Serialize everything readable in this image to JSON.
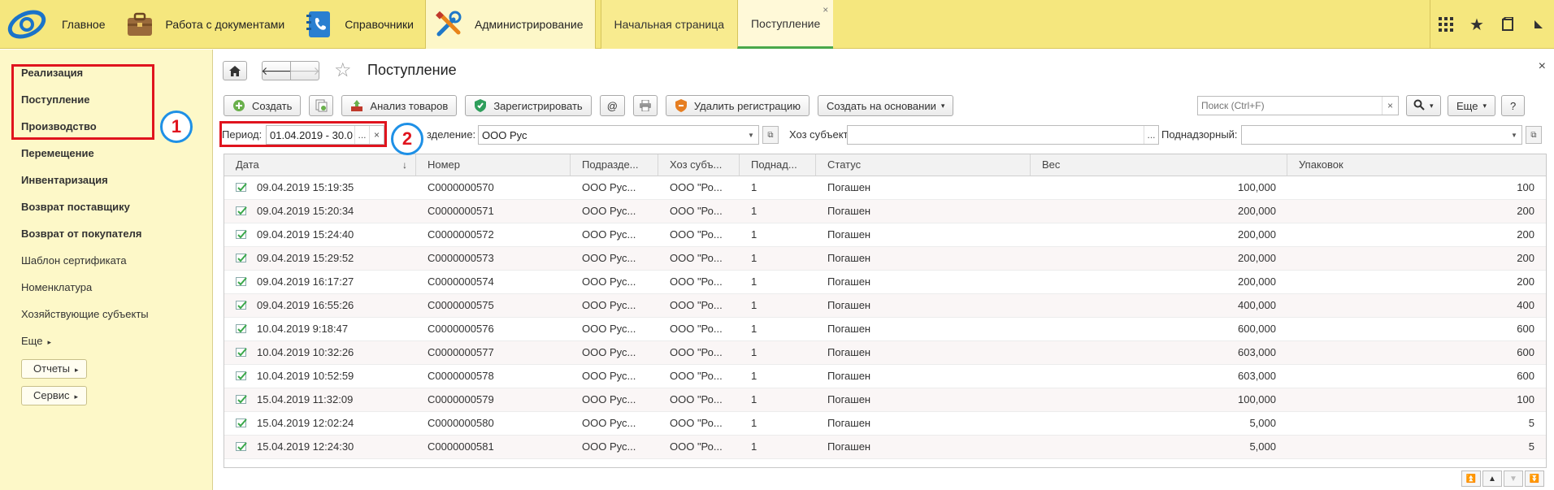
{
  "top_sections": [
    {
      "label": "Главное",
      "icon": "home-logo-icon"
    },
    {
      "label": "Работа с документами",
      "icon": "briefcase-icon"
    },
    {
      "label": "Справочники",
      "icon": "phonebook-icon"
    },
    {
      "label": "Администрирование",
      "icon": "tools-icon"
    }
  ],
  "open_tabs": [
    {
      "label": "Начальная страница"
    },
    {
      "label": "Поступление",
      "close": "×"
    }
  ],
  "top_right_icons": [
    "apps-grid-icon",
    "favorites-star-icon",
    "history-icon"
  ],
  "left_panel": {
    "items": [
      {
        "label": "Реализация",
        "bold": true
      },
      {
        "label": "Поступление",
        "bold": true
      },
      {
        "label": "Производство",
        "bold": true
      },
      {
        "label": "Перемещение",
        "bold": true
      },
      {
        "label": "Инвентаризация",
        "bold": true
      },
      {
        "label": "Возврат поставщику",
        "bold": true
      },
      {
        "label": "Возврат от покупателя",
        "bold": true
      },
      {
        "label": "Шаблон сертификата",
        "bold": false
      },
      {
        "label": "Номенклатура",
        "bold": false
      },
      {
        "label": "Хозяйствующие субъекты",
        "bold": false
      }
    ],
    "more_label": "Еще",
    "buttons": [
      "Отчеты",
      "Сервис"
    ]
  },
  "annotations": {
    "one": "1",
    "two": "2"
  },
  "form": {
    "title": "Поступление",
    "close": "×",
    "commands": {
      "create": "Создать",
      "analysis": "Анализ товаров",
      "register": "Зарегистрировать",
      "at": "@",
      "cancel_registration": "Удалить регистрацию",
      "create_based_on": "Создать на основании",
      "more": "Еще",
      "help": "?"
    },
    "search": {
      "placeholder": "Поиск (Ctrl+F)",
      "clear": "×"
    },
    "filters": {
      "period_label": "Период:",
      "period_value": "01.04.2019 - 30.0",
      "period_dots": "...",
      "period_clear": "×",
      "division_label": "зделение:",
      "division_value": "ООО Рус",
      "subject_label": "Хоз субъект:",
      "subject_value": "",
      "subject_dots": "...",
      "supervised_label": "Поднадзорный:",
      "supervised_value": ""
    }
  },
  "table": {
    "columns": [
      "Дата",
      "Номер",
      "Подразде...",
      "Хоз субъ...",
      "Поднад...",
      "Статус",
      "Вес",
      "Упаковок"
    ],
    "sort_indicator": "↓",
    "rows": [
      {
        "date": "09.04.2019 15:19:35",
        "number": "С0000000570",
        "division": "ООО Рус...",
        "subject": "ООО \"Ро...",
        "supervised": "1",
        "status": "Погашен",
        "weight": "100,000",
        "packages": "100"
      },
      {
        "date": "09.04.2019 15:20:34",
        "number": "С0000000571",
        "division": "ООО Рус...",
        "subject": "ООО \"Ро...",
        "supervised": "1",
        "status": "Погашен",
        "weight": "200,000",
        "packages": "200"
      },
      {
        "date": "09.04.2019 15:24:40",
        "number": "С0000000572",
        "division": "ООО Рус...",
        "subject": "ООО \"Ро...",
        "supervised": "1",
        "status": "Погашен",
        "weight": "200,000",
        "packages": "200"
      },
      {
        "date": "09.04.2019 15:29:52",
        "number": "С0000000573",
        "division": "ООО Рус...",
        "subject": "ООО \"Ро...",
        "supervised": "1",
        "status": "Погашен",
        "weight": "200,000",
        "packages": "200"
      },
      {
        "date": "09.04.2019 16:17:27",
        "number": "С0000000574",
        "division": "ООО Рус...",
        "subject": "ООО \"Ро...",
        "supervised": "1",
        "status": "Погашен",
        "weight": "200,000",
        "packages": "200"
      },
      {
        "date": "09.04.2019 16:55:26",
        "number": "С0000000575",
        "division": "ООО Рус...",
        "subject": "ООО \"Ро...",
        "supervised": "1",
        "status": "Погашен",
        "weight": "400,000",
        "packages": "400"
      },
      {
        "date": "10.04.2019 9:18:47",
        "number": "С0000000576",
        "division": "ООО Рус...",
        "subject": "ООО \"Ро...",
        "supervised": "1",
        "status": "Погашен",
        "weight": "600,000",
        "packages": "600"
      },
      {
        "date": "10.04.2019 10:32:26",
        "number": "С0000000577",
        "division": "ООО Рус...",
        "subject": "ООО \"Ро...",
        "supervised": "1",
        "status": "Погашен",
        "weight": "603,000",
        "packages": "600"
      },
      {
        "date": "10.04.2019 10:52:59",
        "number": "С0000000578",
        "division": "ООО Рус...",
        "subject": "ООО \"Ро...",
        "supervised": "1",
        "status": "Погашен",
        "weight": "603,000",
        "packages": "600"
      },
      {
        "date": "15.04.2019 11:32:09",
        "number": "С0000000579",
        "division": "ООО Рус...",
        "subject": "ООО \"Ро...",
        "supervised": "1",
        "status": "Погашен",
        "weight": "100,000",
        "packages": "100"
      },
      {
        "date": "15.04.2019 12:02:24",
        "number": "С0000000580",
        "division": "ООО Рус...",
        "subject": "ООО \"Ро...",
        "supervised": "1",
        "status": "Погашен",
        "weight": "5,000",
        "packages": "5"
      },
      {
        "date": "15.04.2019 12:24:30",
        "number": "С0000000581",
        "division": "ООО Рус...",
        "subject": "ООО \"Ро...",
        "supervised": "1",
        "status": "Погашен",
        "weight": "5,000",
        "packages": "5"
      }
    ]
  },
  "colors": {
    "topbar": "#f5e77e",
    "left_panel": "#fdf8c8",
    "highlight_red": "#e0141e",
    "annotation_blue": "#1e90e6"
  }
}
